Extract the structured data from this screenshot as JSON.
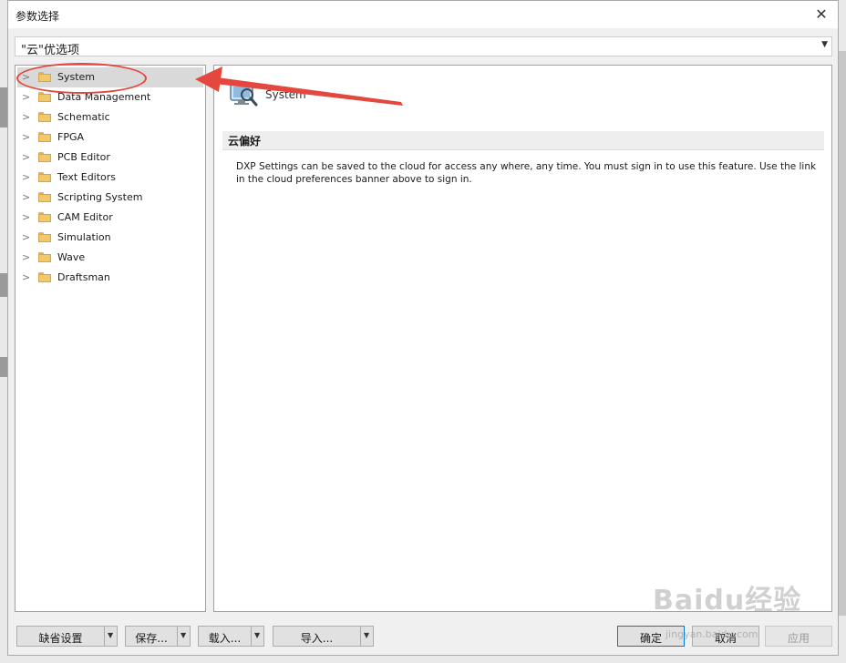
{
  "window": {
    "title": "参数选择"
  },
  "combo": {
    "value": "\"云\"优选项"
  },
  "tree": {
    "items": [
      {
        "label": "System",
        "selected": true
      },
      {
        "label": "Data Management"
      },
      {
        "label": "Schematic"
      },
      {
        "label": "FPGA"
      },
      {
        "label": "PCB Editor"
      },
      {
        "label": "Text Editors"
      },
      {
        "label": "Scripting System"
      },
      {
        "label": "CAM Editor"
      },
      {
        "label": "Simulation"
      },
      {
        "label": "Wave"
      },
      {
        "label": "Draftsman"
      }
    ]
  },
  "panel": {
    "header_title": "System",
    "section_title": "云偏好",
    "description": "DXP Settings can be saved to the cloud for access any where, any time. You must sign in to use this feature. Use the link in the cloud preferences banner above to sign in."
  },
  "buttons": {
    "defaults": "缺省设置",
    "save": "保存...",
    "load": "载入...",
    "import": "导入...",
    "ok": "确定",
    "cancel": "取消",
    "apply": "应用"
  },
  "watermark": {
    "text": "Baidu经验",
    "sub": "jingyan.baidu.com"
  },
  "colors": {
    "annotation": "#e4473d",
    "accent": "#0078d7"
  }
}
